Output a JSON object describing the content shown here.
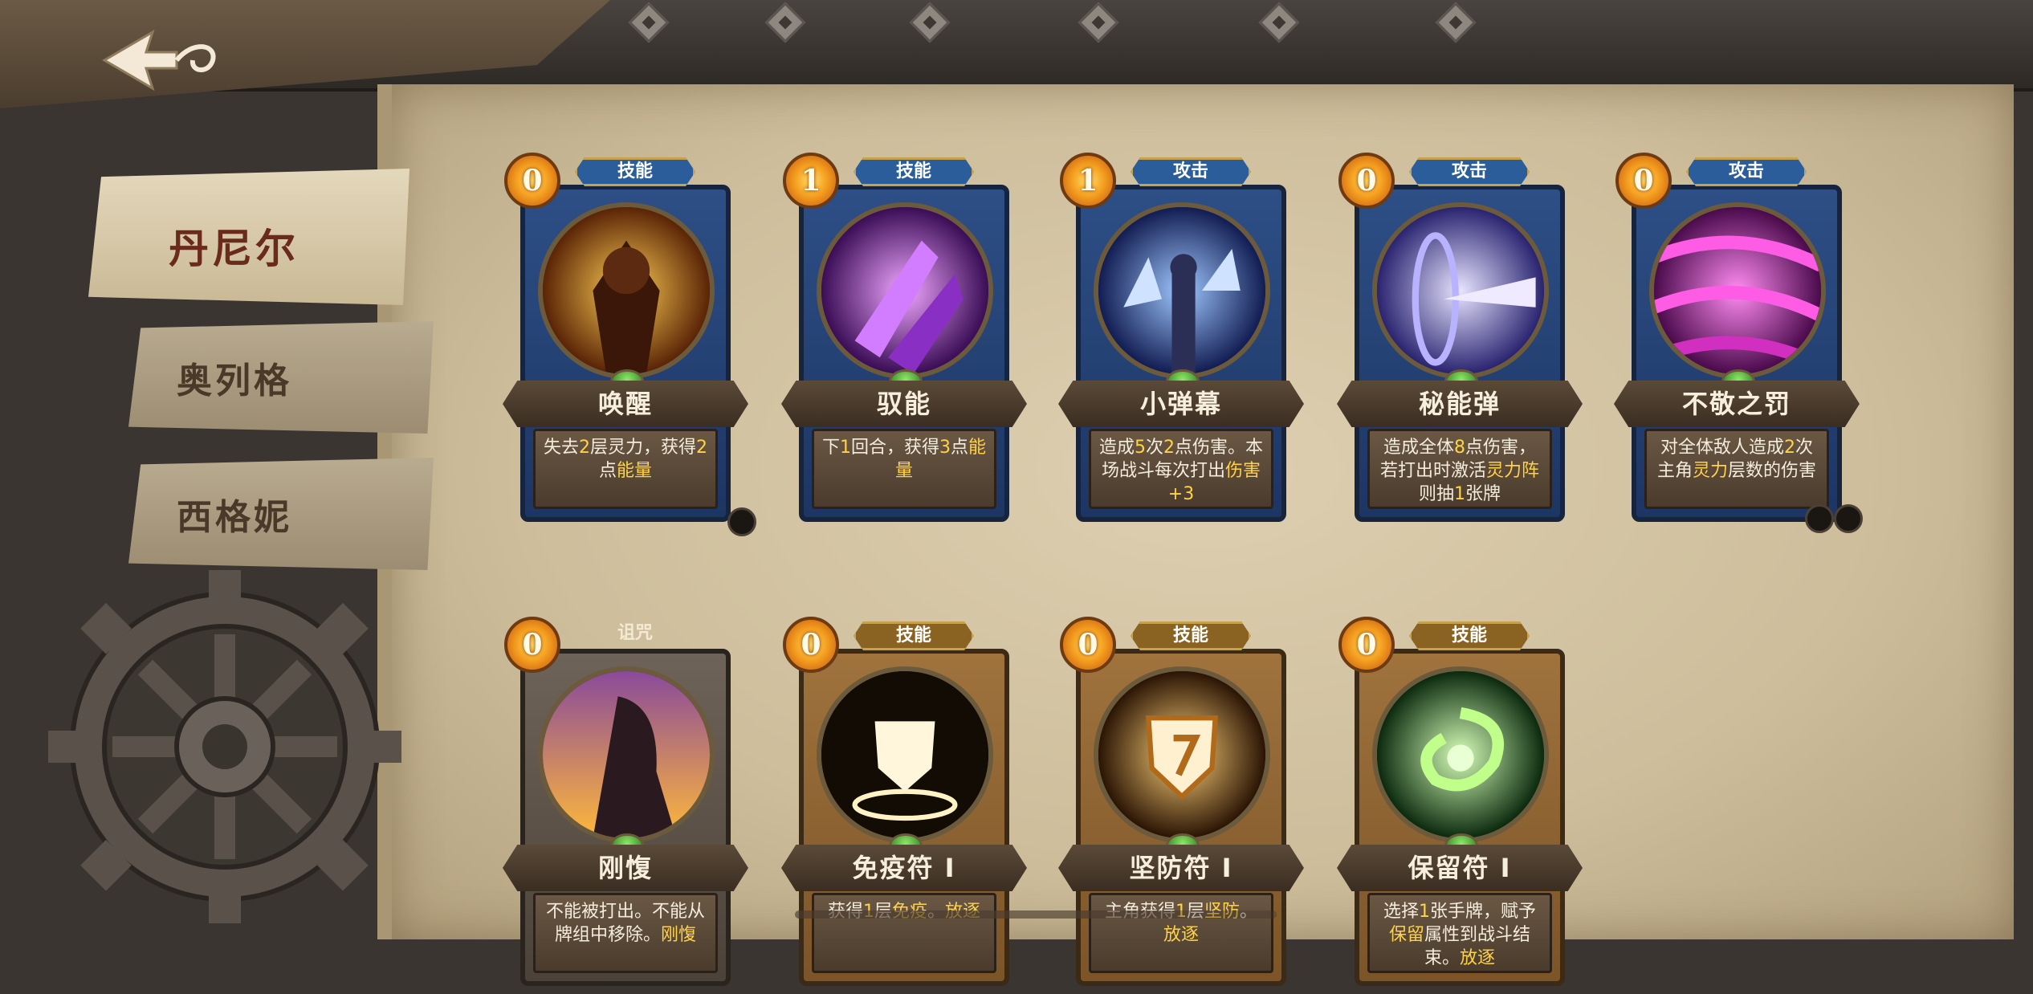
{
  "characters": [
    {
      "name": "丹尼尔",
      "active": true
    },
    {
      "name": "奥列格",
      "active": false
    },
    {
      "name": "西格妮",
      "active": false
    }
  ],
  "cards_row1": [
    {
      "cost": "0",
      "type": "技能",
      "name": "唤醒",
      "desc_parts": [
        "失去",
        "2",
        "层灵力，获得",
        "2",
        "点",
        "能量"
      ],
      "frame": "blue"
    },
    {
      "cost": "1",
      "type": "技能",
      "name": "驭能",
      "desc_parts": [
        "下",
        "1",
        "回合，获得",
        "3",
        "点",
        "能量"
      ],
      "frame": "blue"
    },
    {
      "cost": "1",
      "type": "攻击",
      "name": "小弹幕",
      "desc_parts": [
        "造成",
        "5",
        "次",
        "2",
        "点伤害。本场战斗每次打出",
        "伤害+3"
      ],
      "frame": "blue"
    },
    {
      "cost": "0",
      "type": "攻击",
      "name": "秘能弹",
      "desc_parts": [
        "造成全体",
        "8",
        "点伤害，若打出时激活",
        "灵力阵",
        "则抽",
        "1",
        "张牌"
      ],
      "frame": "blue"
    },
    {
      "cost": "0",
      "type": "攻击",
      "name": "不敬之罚",
      "desc_parts": [
        "对全体敌人造成",
        "2",
        "次主角",
        "灵力",
        "层数的伤害"
      ],
      "frame": "blue"
    }
  ],
  "cards_row2": [
    {
      "cost": "0",
      "type": "诅咒",
      "name": "刚愎",
      "desc_parts": [
        "不能被打出。不能从牌组中移除。",
        "刚愎"
      ],
      "frame": "dark"
    },
    {
      "cost": "0",
      "type": "技能",
      "name": "免疫符 I",
      "desc_parts": [
        "获得",
        "1",
        "层",
        "免疫",
        "。",
        "放逐"
      ],
      "frame": "brown"
    },
    {
      "cost": "0",
      "type": "技能",
      "name": "坚防符 I",
      "desc_parts": [
        "主角获得",
        "1",
        "层",
        "坚防",
        "。",
        "放逐"
      ],
      "frame": "brown"
    },
    {
      "cost": "0",
      "type": "技能",
      "name": "保留符 I",
      "desc_parts": [
        "选择",
        "1",
        "张手牌，赋予",
        "保留",
        "属性到战斗结束。",
        "放逐"
      ],
      "frame": "brown"
    }
  ],
  "icons": {
    "back": "back-arrow-icon",
    "gear": "gear-icon",
    "cost": "energy-orb-icon",
    "gem": "green-gem-icon"
  },
  "colors": {
    "highlight": "#ffd24a",
    "accent_number": "#ffd24a",
    "parchment": "#cdbd9b"
  }
}
